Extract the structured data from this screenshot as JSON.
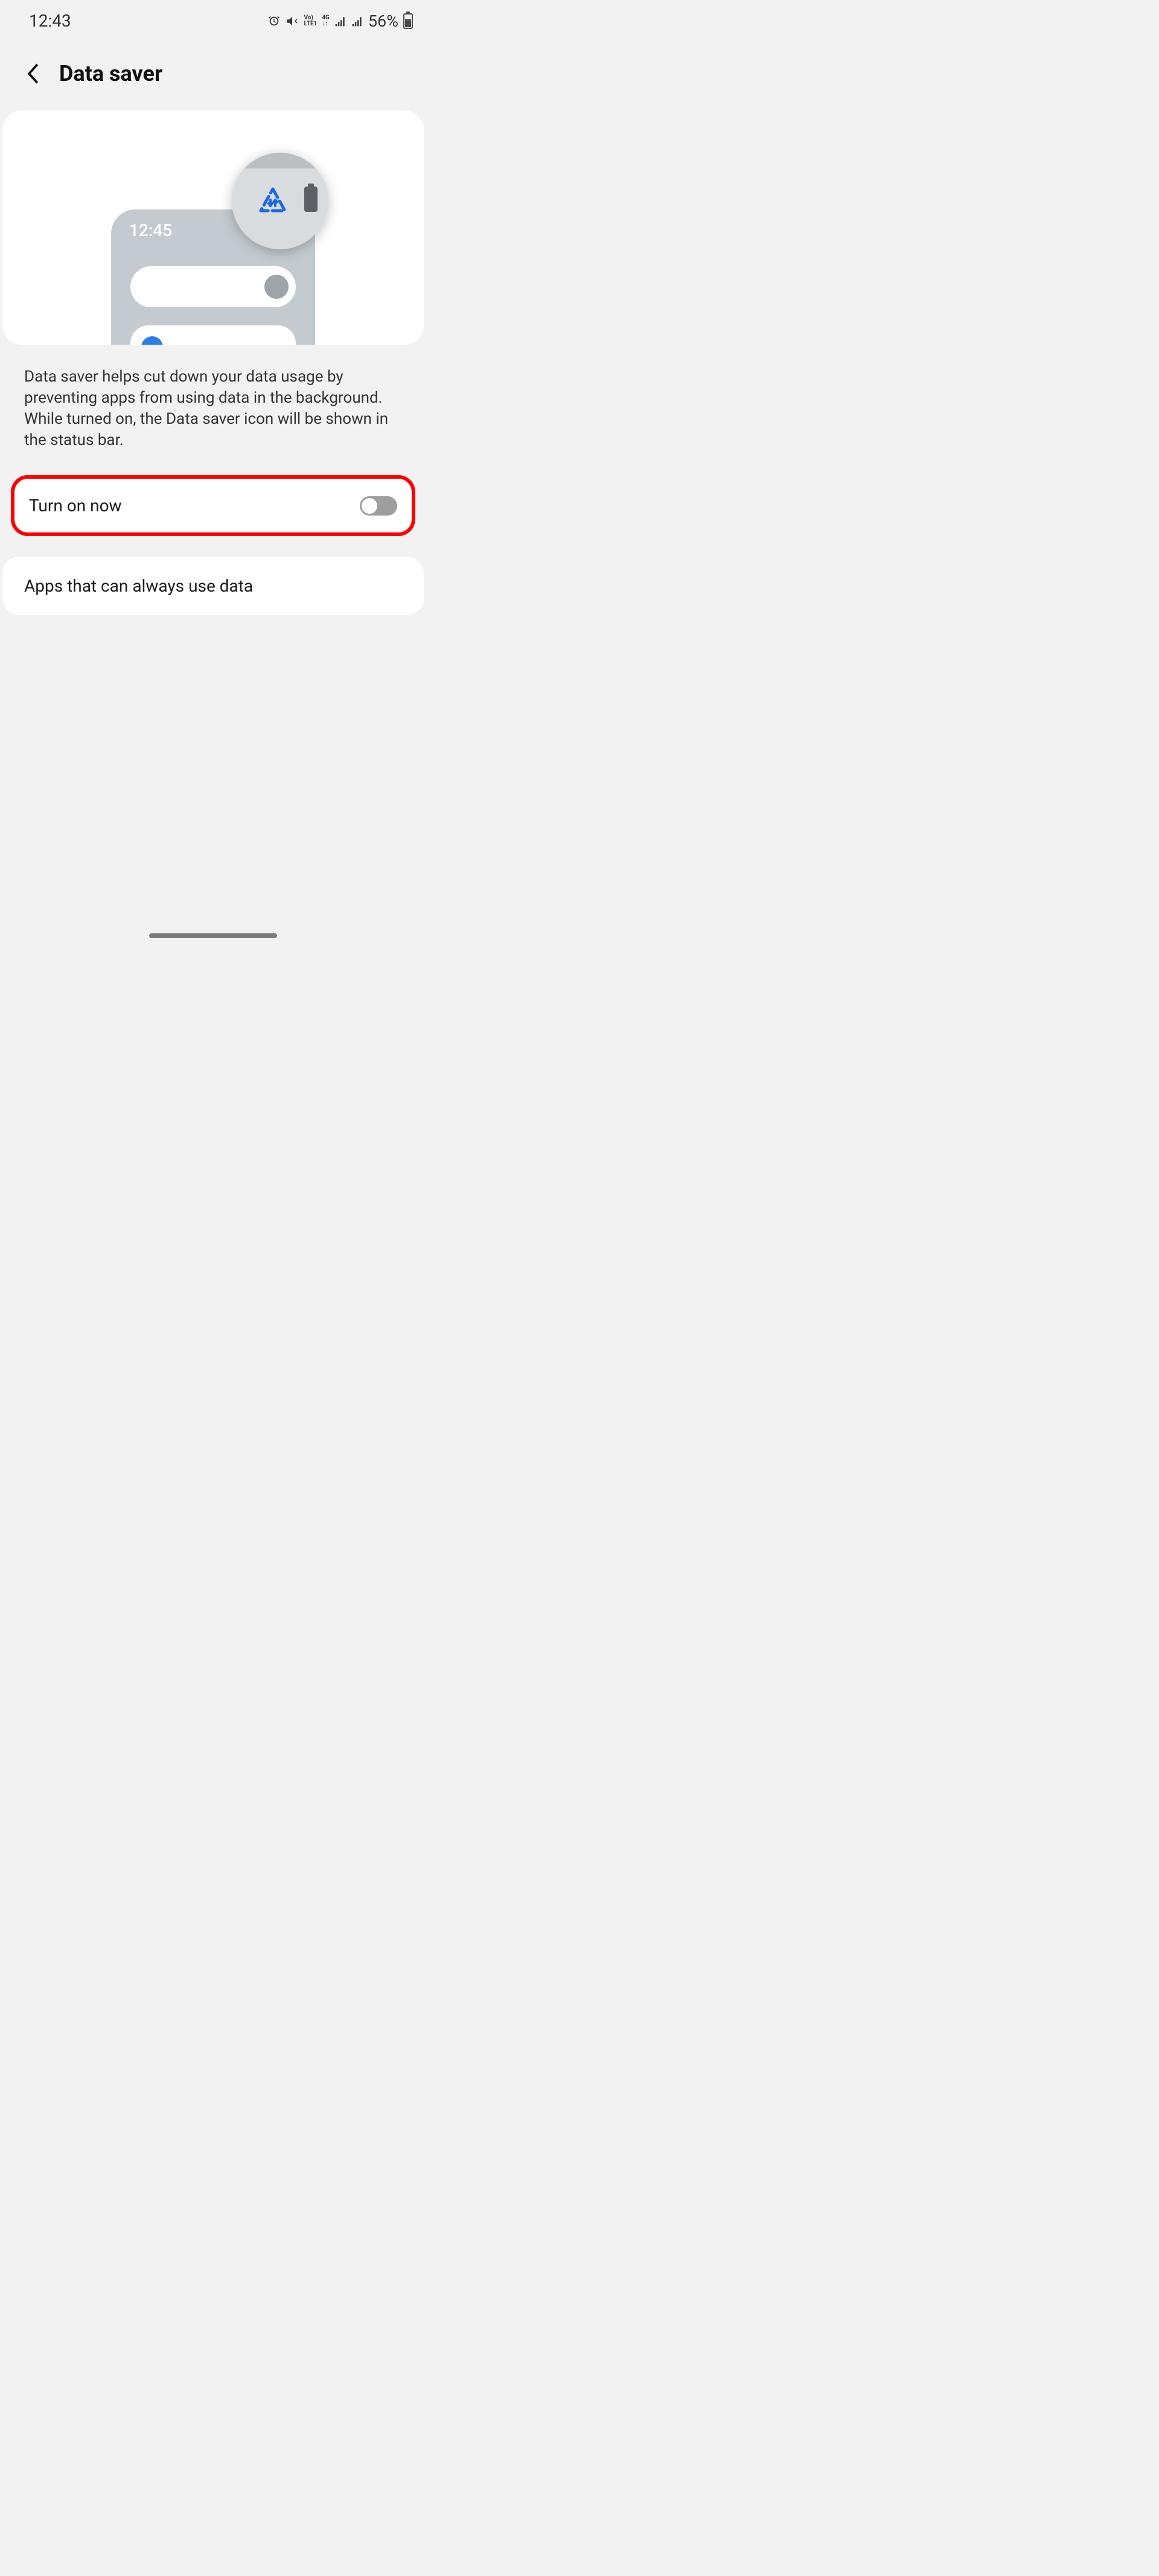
{
  "status_bar": {
    "time": "12:43",
    "battery_pct": "56%"
  },
  "header": {
    "title": "Data saver"
  },
  "illustration": {
    "phone_time": "12:45"
  },
  "content": {
    "description": "Data saver helps cut down your data usage by preventing apps from using data in the background. While turned on, the Data saver icon will be shown in the status bar.",
    "toggle_label": "Turn on now",
    "toggle_state": false,
    "apps_label": "Apps that can always use data"
  },
  "highlight": {
    "target": "turn-on-toggle-row",
    "color": "#ff0000"
  }
}
